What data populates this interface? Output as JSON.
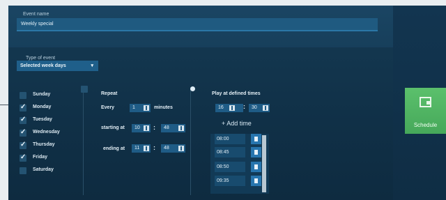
{
  "event_name": {
    "label": "Event name",
    "value": "Weekly special"
  },
  "event_type": {
    "label": "Type of event",
    "selected": "Selected week days",
    "caret": "▾"
  },
  "days": [
    {
      "label": "Sunday",
      "checked": false
    },
    {
      "label": "Monday",
      "checked": true
    },
    {
      "label": "Tuesday",
      "checked": true
    },
    {
      "label": "Wednesday",
      "checked": true
    },
    {
      "label": "Thursday",
      "checked": true
    },
    {
      "label": "Friday",
      "checked": true
    },
    {
      "label": "Saturday",
      "checked": false
    }
  ],
  "repeat": {
    "label": "Repeat",
    "every_label": "Every",
    "every_value": "1",
    "unit": "minutes",
    "starting_label": "starting at",
    "start_h": "10",
    "start_m": "48",
    "ending_label": "ending at",
    "end_h": "11",
    "end_m": "48",
    "colon": ":"
  },
  "defined": {
    "label": "Play at defined times",
    "hour": "16",
    "minute": "30",
    "colon": ":",
    "add_label": "+ Add time",
    "times": [
      "08:00",
      "08:45",
      "08:50",
      "09:35"
    ]
  },
  "schedule_button": {
    "label": "Schedule",
    "color": "#4fb462"
  }
}
